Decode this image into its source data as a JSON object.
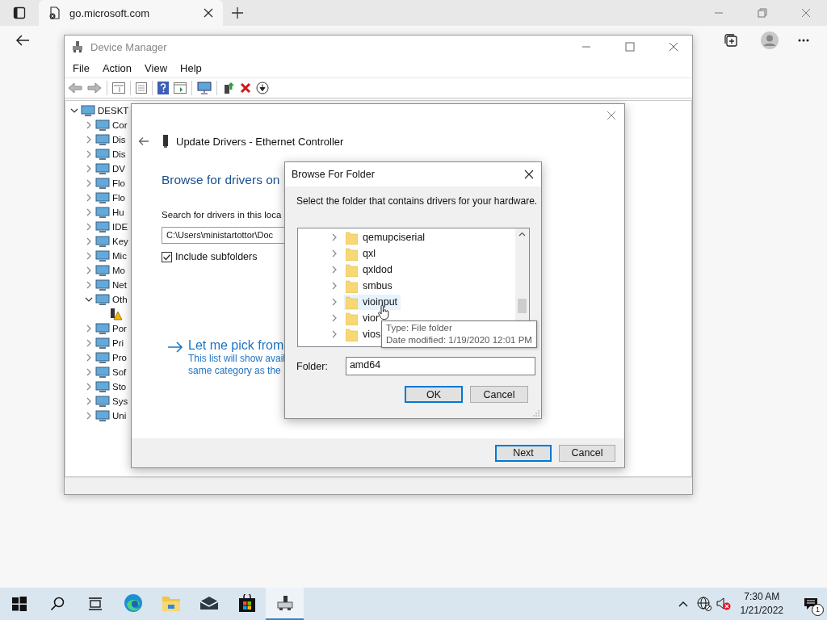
{
  "browser": {
    "tab": {
      "title": "go.microsoft.com"
    }
  },
  "device_manager": {
    "title": "Device Manager",
    "menu": [
      "File",
      "Action",
      "View",
      "Help"
    ],
    "tree": [
      {
        "label": "DESKT",
        "expanded": true,
        "children": [
          {
            "label": "Cor",
            "expanded": false
          },
          {
            "label": "Dis",
            "expanded": false
          },
          {
            "label": "Dis",
            "expanded": false
          },
          {
            "label": "DV",
            "expanded": false
          },
          {
            "label": "Flo",
            "expanded": false
          },
          {
            "label": "Flo",
            "expanded": false
          },
          {
            "label": "Hu",
            "expanded": false
          },
          {
            "label": "IDE",
            "expanded": false
          },
          {
            "label": "Key",
            "expanded": false
          },
          {
            "label": "Mic",
            "expanded": false
          },
          {
            "label": "Mo",
            "expanded": false
          },
          {
            "label": "Net",
            "expanded": false
          },
          {
            "label": "Oth",
            "expanded": true,
            "children": [
              {
                "kind": "warning"
              }
            ]
          },
          {
            "label": "Por",
            "expanded": false
          },
          {
            "label": "Pri",
            "expanded": false
          },
          {
            "label": "Pro",
            "expanded": false
          },
          {
            "label": "Sof",
            "expanded": false
          },
          {
            "label": "Sto",
            "expanded": false
          },
          {
            "label": "Sys",
            "expanded": false
          },
          {
            "label": "Uni",
            "expanded": false
          }
        ]
      }
    ]
  },
  "update_wizard": {
    "title": "Update Drivers - Ethernet Controller",
    "heading": "Browse for drivers on",
    "search_label": "Search for drivers in this loca",
    "path": "C:\\Users\\ministartottor\\Doc",
    "include_subfolders": {
      "label": "Include subfolders",
      "checked": true
    },
    "pick_link": {
      "title": "Let me pick from",
      "description": [
        "This list will show avail",
        "same category as the"
      ]
    },
    "buttons": [
      {
        "label": "Next",
        "default": true
      },
      {
        "label": "Cancel",
        "default": false
      }
    ]
  },
  "browse_dialog": {
    "title": "Browse For Folder",
    "instruction": "Select the folder that contains drivers for your hardware.",
    "folders": [
      {
        "label": "qemupciserial",
        "hovered": false
      },
      {
        "label": "qxl",
        "hovered": false
      },
      {
        "label": "qxldod",
        "hovered": false
      },
      {
        "label": "smbus",
        "hovered": false
      },
      {
        "label": "vioinput",
        "hovered": true
      },
      {
        "label": "vior",
        "hovered": false
      },
      {
        "label": "vios",
        "hovered": false
      }
    ],
    "folder_field": {
      "label": "Folder:",
      "value": "amd64"
    },
    "buttons": [
      {
        "label": "OK",
        "default": true
      },
      {
        "label": "Cancel",
        "default": false
      }
    ],
    "tooltip": [
      "Type: File folder",
      "Date modified: 1/19/2020 12:01 PM"
    ]
  },
  "taskbar": {
    "apps": [
      {
        "kind": "edge",
        "active": false
      },
      {
        "kind": "explorer",
        "active": false
      },
      {
        "kind": "mail",
        "active": false
      },
      {
        "kind": "store",
        "active": false
      },
      {
        "kind": "device-manager",
        "active": true
      }
    ],
    "clock": {
      "time": "7:30 AM",
      "date": "1/21/2022"
    },
    "notifications": {
      "count": "1"
    }
  }
}
